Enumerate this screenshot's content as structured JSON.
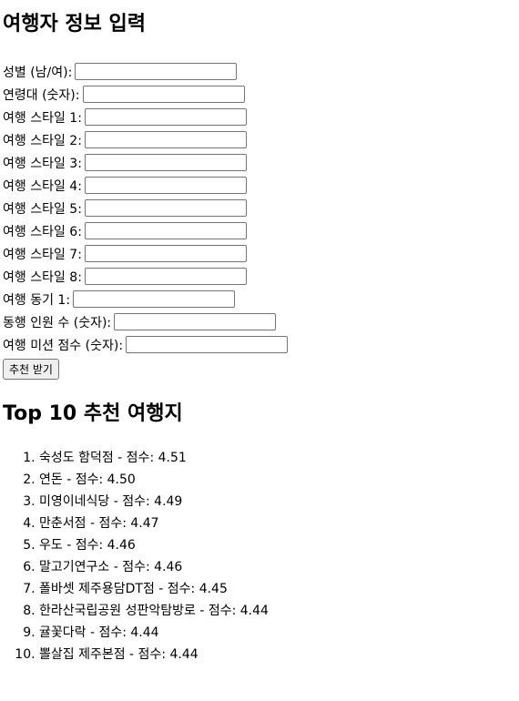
{
  "form": {
    "title": "여행자 정보 입력",
    "fields": [
      {
        "label": "성별 (남/여):",
        "value": ""
      },
      {
        "label": "연령대 (숫자):",
        "value": ""
      },
      {
        "label": "여행 스타일 1:",
        "value": ""
      },
      {
        "label": "여행 스타일 2:",
        "value": ""
      },
      {
        "label": "여행 스타일 3:",
        "value": ""
      },
      {
        "label": "여행 스타일 4:",
        "value": ""
      },
      {
        "label": "여행 스타일 5:",
        "value": ""
      },
      {
        "label": "여행 스타일 6:",
        "value": ""
      },
      {
        "label": "여행 스타일 7:",
        "value": ""
      },
      {
        "label": "여행 스타일 8:",
        "value": ""
      },
      {
        "label": "여행 동기 1:",
        "value": ""
      },
      {
        "label": "동행 인원 수 (숫자):",
        "value": ""
      },
      {
        "label": "여행 미션 점수 (숫자):",
        "value": ""
      }
    ],
    "submit_label": "추천 받기"
  },
  "results": {
    "title": "Top 10 추천 여행지",
    "items": [
      {
        "text": "숙성도 함덕점 - 점수: 4.51"
      },
      {
        "text": "연돈 - 점수: 4.50"
      },
      {
        "text": "미영이네식당 - 점수: 4.49"
      },
      {
        "text": "만춘서점 - 점수: 4.47"
      },
      {
        "text": "우도 - 점수: 4.46"
      },
      {
        "text": "말고기연구소 - 점수: 4.46"
      },
      {
        "text": "폴바셋 제주용담DT점 - 점수: 4.45"
      },
      {
        "text": "한라산국립공원 성판악탐방로 - 점수: 4.44"
      },
      {
        "text": "귤꽃다락 - 점수: 4.44"
      },
      {
        "text": "뽈살집 제주본점 - 점수: 4.44"
      }
    ]
  }
}
